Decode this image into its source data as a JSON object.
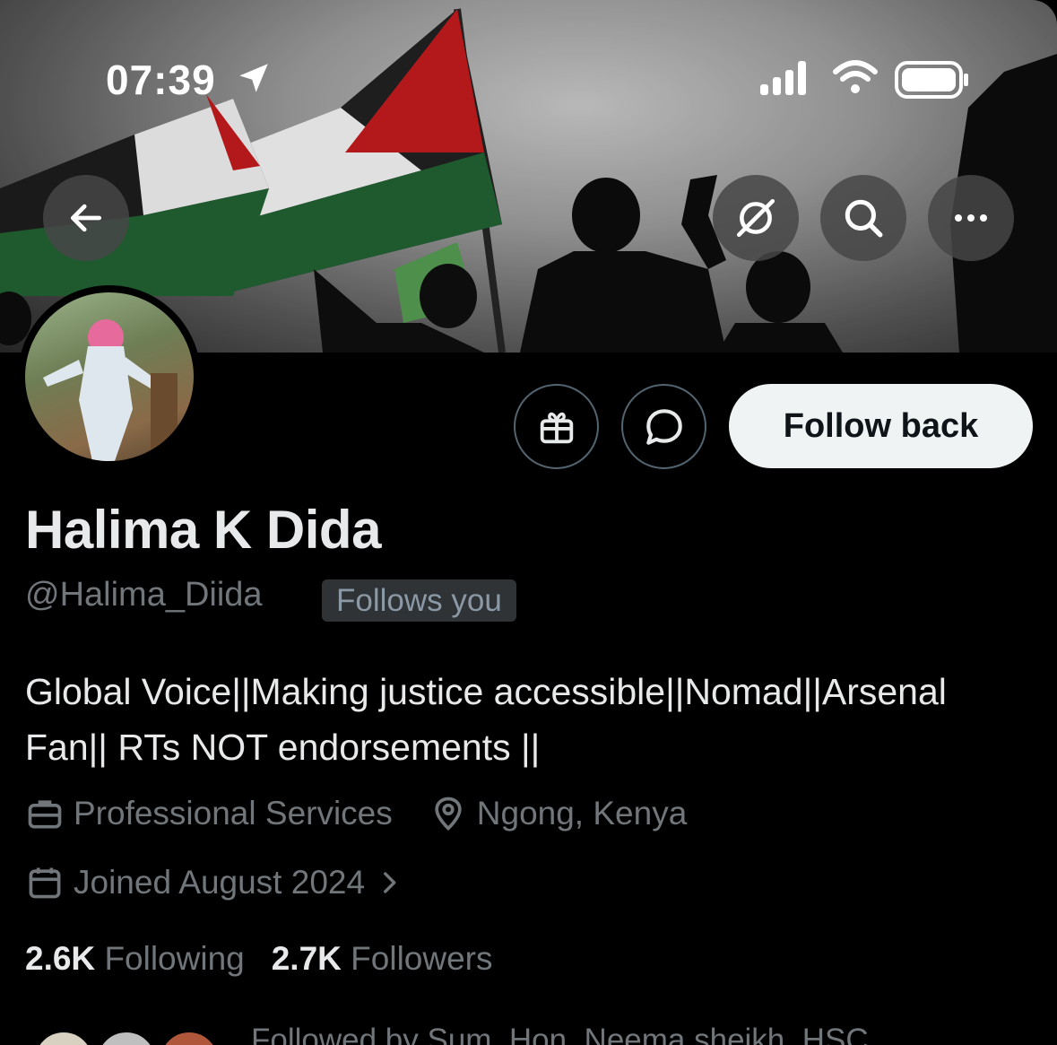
{
  "status_bar": {
    "time": "07:39"
  },
  "profile": {
    "name": "Halima K Dida",
    "handle": "@Halima_Diida",
    "follows_you_badge": "Follows you",
    "follow_button_label": "Follow back",
    "bio_line1": "Global Voice||Making justice accessible||Nomad||Arsenal",
    "bio_line2": "Fan|| RTs NOT endorsements ||",
    "category": "Professional Services",
    "location": "Ngong, Kenya",
    "joined": "Joined August 2024",
    "following_count": "2.6K",
    "following_label": "Following",
    "followers_count": "2.7K",
    "followers_label": "Followers",
    "followed_by": "Followed by Sum, Hon. Neema sheikh, HSC"
  },
  "icons": {
    "back": "arrow-left-icon",
    "translate": "translate-icon",
    "search": "search-icon",
    "more": "more-icon",
    "gift": "gift-icon",
    "message": "message-icon",
    "briefcase": "briefcase-icon",
    "location": "location-pin-icon",
    "calendar": "calendar-icon"
  },
  "colors": {
    "background": "#000000",
    "primary_text": "#e7e9ea",
    "secondary_text": "#71767b",
    "button_bg": "#eff3f4"
  }
}
